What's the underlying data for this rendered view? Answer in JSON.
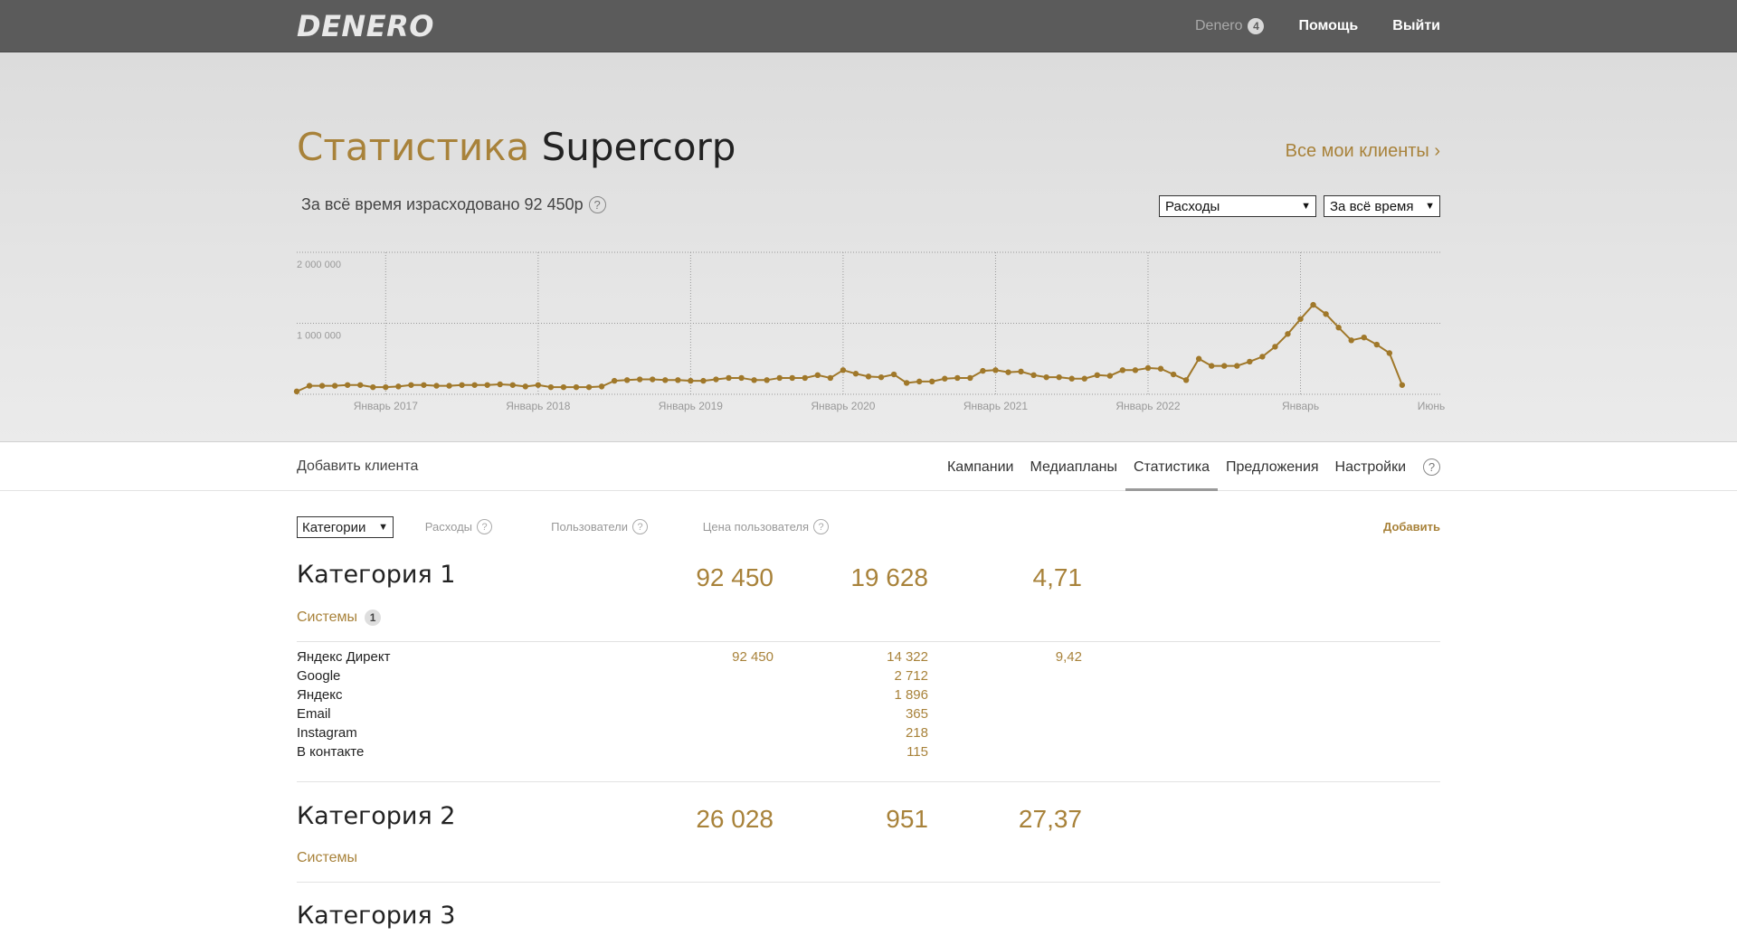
{
  "header": {
    "logo": "DENERO",
    "account": "Denero",
    "account_badge": "4",
    "help": "Помощь",
    "logout": "Выйти"
  },
  "hero": {
    "title_prefix": "Статистика",
    "title_client": "Supercorp",
    "all_clients": "Все мои клиенты ›",
    "spent_text": "За всё время израсходовано 92 450р",
    "metric_select": "Расходы",
    "period_select": "За всё время"
  },
  "chart_data": {
    "type": "line",
    "color": "#a0782a",
    "ylim": [
      0,
      2000000
    ],
    "y_ticks": [
      "2 000 000",
      "1 000 000"
    ],
    "x_ticks": [
      "Январь 2017",
      "Январь 2018",
      "Январь 2019",
      "Январь 2020",
      "Январь 2021",
      "Январь 2022",
      "Январь",
      "Июнь"
    ],
    "values": [
      40000,
      120000,
      120000,
      120000,
      130000,
      130000,
      100000,
      100000,
      110000,
      130000,
      130000,
      120000,
      120000,
      130000,
      130000,
      130000,
      140000,
      130000,
      110000,
      130000,
      100000,
      100000,
      100000,
      100000,
      110000,
      190000,
      200000,
      210000,
      210000,
      200000,
      200000,
      190000,
      190000,
      210000,
      230000,
      230000,
      200000,
      200000,
      230000,
      230000,
      230000,
      270000,
      230000,
      340000,
      290000,
      250000,
      240000,
      280000,
      160000,
      180000,
      180000,
      220000,
      230000,
      230000,
      330000,
      340000,
      310000,
      320000,
      270000,
      240000,
      240000,
      220000,
      220000,
      270000,
      260000,
      340000,
      340000,
      370000,
      360000,
      280000,
      200000,
      500000,
      400000,
      400000,
      400000,
      460000,
      530000,
      670000,
      850000,
      1060000,
      1260000,
      1130000,
      940000,
      760000,
      800000,
      700000,
      580000,
      130000
    ]
  },
  "tabs": {
    "add_client": "Добавить клиента",
    "items": [
      "Кампании",
      "Медиапланы",
      "Статистика",
      "Предложения",
      "Настройки"
    ],
    "help": "?"
  },
  "table": {
    "group_select": "Категории",
    "col_spend": "Расходы",
    "col_users": "Пользователи",
    "col_price": "Цена пользователя",
    "add": "Добавить",
    "categories": [
      {
        "name": "Категория 1",
        "spend": "92 450",
        "users": "19 628",
        "price": "4,71",
        "systems_label": "Системы",
        "systems_count": "1",
        "rows": [
          {
            "name": "Яндекс Директ",
            "spend": "92 450",
            "users": "14 322",
            "price": "9,42"
          },
          {
            "name": "Google",
            "spend": "",
            "users": "2 712",
            "price": ""
          },
          {
            "name": "Яндекс",
            "spend": "",
            "users": "1 896",
            "price": ""
          },
          {
            "name": "Email",
            "spend": "",
            "users": "365",
            "price": ""
          },
          {
            "name": "Instagram",
            "spend": "",
            "users": "218",
            "price": ""
          },
          {
            "name": "В контакте",
            "spend": "",
            "users": "115",
            "price": ""
          }
        ]
      },
      {
        "name": "Категория 2",
        "spend": "26 028",
        "users": "951",
        "price": "27,37",
        "systems_label": "Системы"
      },
      {
        "name": "Категория 3"
      }
    ]
  },
  "icons": {
    "help": "help-circle-icon",
    "dropdown": "chevron-down-icon"
  }
}
